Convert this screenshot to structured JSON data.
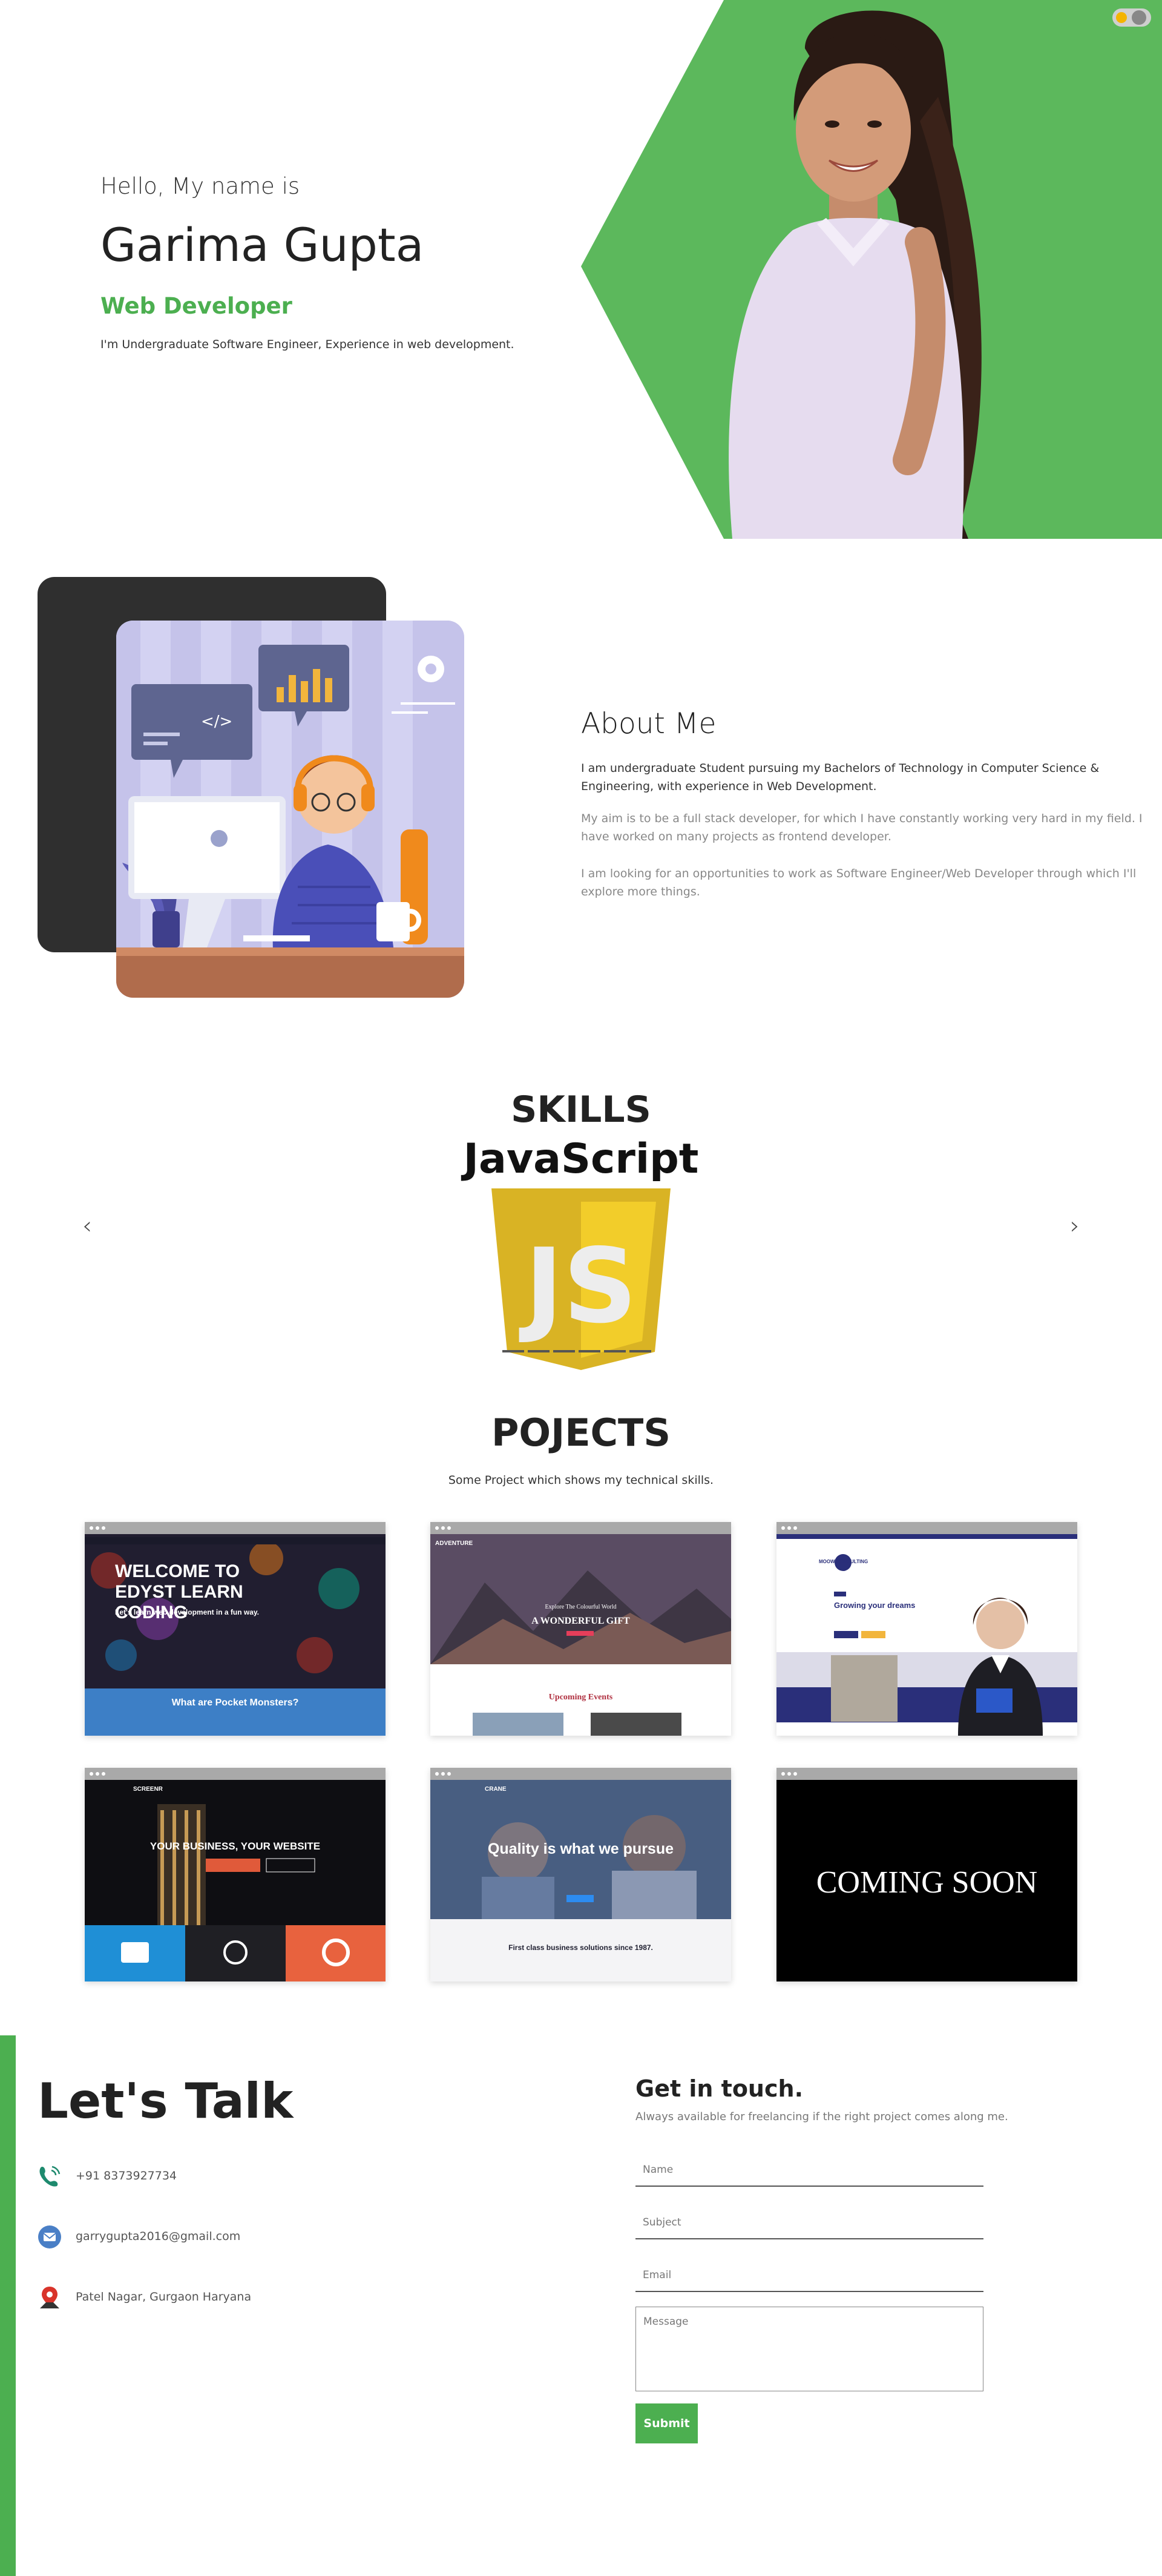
{
  "hero": {
    "greeting": "Hello, My name is",
    "name": "Garima Gupta",
    "role": "Web Developer",
    "description": "I'm Undergraduate Software Engineer, Experience in web development.",
    "accent_color": "#4caf50"
  },
  "theme_toggle": {
    "icon": "sun-icon"
  },
  "about": {
    "title": "About Me",
    "paragraph1": "I am undergraduate Student pursuing my Bachelors of Technology in Computer Science & Engineering, with experience in Web Development.",
    "paragraph2": "My aim is to be a full stack developer, for which I have constantly working very hard in my field. I have worked on many projects as frontend developer.",
    "paragraph3": "I am looking for an opportunities to work as Software Engineer/Web Developer through which I'll explore more things."
  },
  "skills": {
    "title": "SKILLS",
    "current_skill": "JavaScript",
    "logo_text": "JS",
    "prev_label": "‹",
    "next_label": "›"
  },
  "projects": {
    "title": "POJECTS",
    "subtitle": "Some Project which shows my technical skills.",
    "cards": [
      {
        "heading": "WELCOME TO EDYST LEARN CODING",
        "tagline": "Let's learn web development in a fun way.",
        "section": "What are Pocket Monsters?"
      },
      {
        "heading": "A WONDERFUL GIFT",
        "brand": "ADVENTURE",
        "subheading": "Explore The Colourful World",
        "section": "Upcoming Events"
      },
      {
        "heading": "Growing your dreams",
        "brand": "MOOW CONSULTING"
      },
      {
        "heading": "YOUR BUSINESS, YOUR WEBSITE",
        "brand": "SCREENR"
      },
      {
        "heading": "Quality is what we pursue",
        "brand": "CRANE",
        "section": "First class business solutions since 1987."
      },
      {
        "heading": "COMING SOON"
      }
    ]
  },
  "contact": {
    "title": "Let's Talk",
    "phone": "+91 8373927734",
    "email": "garrygupta2016@gmail.com",
    "address": "Patel Nagar, Gurgaon Haryana",
    "form_title": "Get in touch.",
    "form_subtitle": "Always available for freelancing if the right project comes along me.",
    "name_placeholder": "Name",
    "subject_placeholder": "Subject",
    "email_placeholder": "Email",
    "message_placeholder": "Message",
    "submit_label": "Submit"
  }
}
